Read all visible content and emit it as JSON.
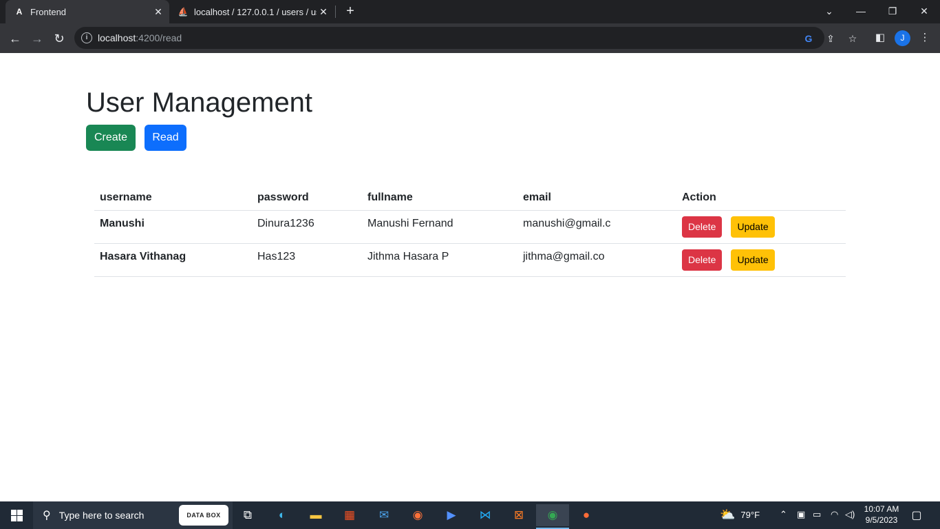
{
  "browser": {
    "tabs": [
      {
        "title": "Frontend",
        "icon": "A"
      },
      {
        "title": "localhost / 127.0.0.1 / users / use",
        "icon": "pma"
      }
    ],
    "url_host": "localhost",
    "url_path": ":4200/read",
    "profile_initial": "J"
  },
  "page": {
    "title": "User Management",
    "buttons": {
      "create": "Create",
      "read": "Read"
    },
    "table": {
      "headers": [
        "username",
        "password",
        "fullname",
        "email",
        "Action"
      ],
      "rows": [
        {
          "username": "Manushi",
          "password": "Dinura1236",
          "fullname": "Manushi Fernand",
          "email": "manushi@gmail.c"
        },
        {
          "username": "Hasara Vithanag",
          "password": "Has123",
          "fullname": "Jithma Hasara P",
          "email": "jithma@gmail.co"
        }
      ],
      "actions": {
        "delete": "Delete",
        "update": "Update"
      }
    },
    "colors": {
      "create": "#198754",
      "read": "#0d6efd",
      "delete": "#dc3545",
      "update": "#ffc107"
    }
  },
  "taskbar": {
    "search_placeholder": "Type here to search",
    "databox_label": "DATA BOX",
    "weather": "79°F",
    "time": "10:07 AM",
    "date": "9/5/2023"
  }
}
